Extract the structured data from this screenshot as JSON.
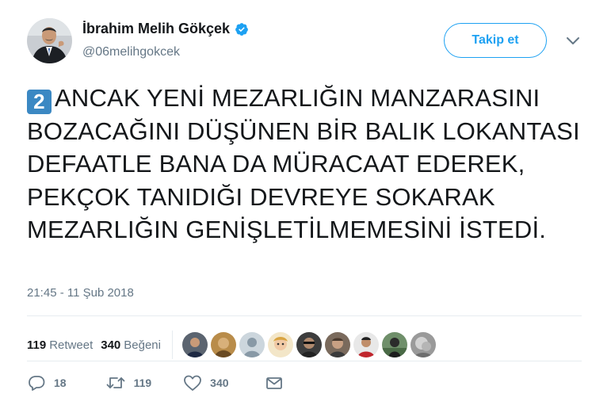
{
  "user": {
    "display_name": "İbrahim Melih Gökçek",
    "handle": "@06melihgokcek",
    "verified": true
  },
  "follow_button": {
    "label": "Takip et"
  },
  "tweet": {
    "keycap": "2",
    "text": "ANCAK YENİ MEZARLIĞIN MANZARASINI BOZACAĞINI DÜŞÜNEN BİR BALIK LOKANTASI DEFAATLE BANA DA MÜRACAAT EDEREK, PEKÇOK TANIDIĞI DEVREYE SOKARAK MEZARLIĞIN GENİŞLETİLMEMESİNİ İSTEDİ.",
    "timestamp": "21:45 - 11 Şub 2018"
  },
  "stats": {
    "retweets_count": "119",
    "retweets_label": "Retweet",
    "likes_count": "340",
    "likes_label": "Beğeni"
  },
  "actions": {
    "reply_count": "18",
    "retweet_count": "119",
    "like_count": "340"
  },
  "colors": {
    "accent": "#1da1f2",
    "muted": "#657786",
    "divider": "#e6ecf0",
    "keycap": "#3b88c3"
  },
  "icons": [
    "verified-badge-icon",
    "chevron-down-icon",
    "reply-icon",
    "retweet-icon",
    "like-icon",
    "direct-message-icon"
  ]
}
